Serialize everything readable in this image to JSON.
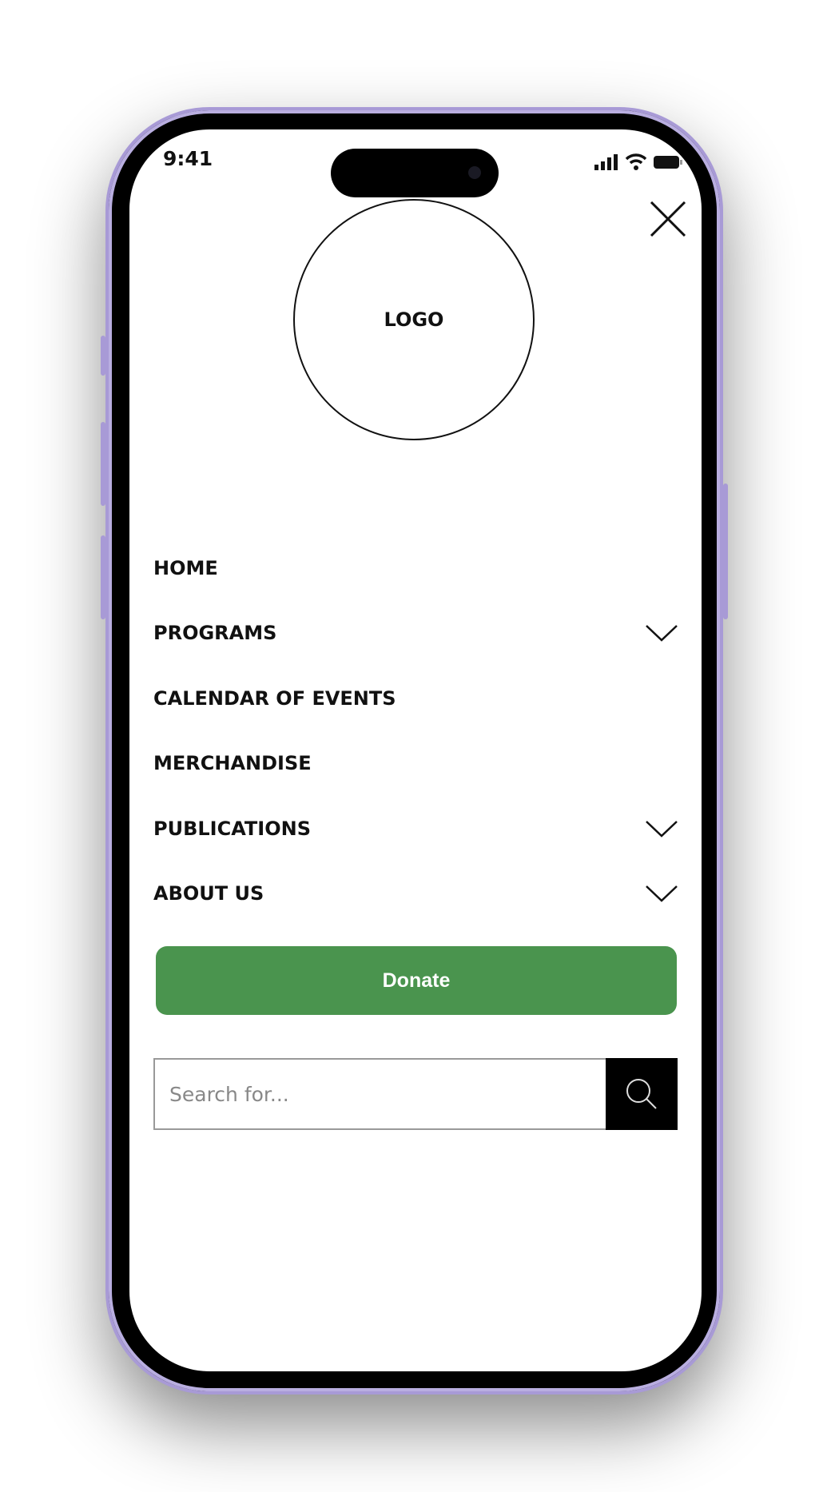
{
  "status_bar": {
    "time": "9:41",
    "icons": [
      "signal-icon",
      "wifi-icon",
      "battery-icon"
    ]
  },
  "header": {
    "logo_text": "LOGO",
    "close_icon": "close-icon"
  },
  "menu": {
    "items": [
      {
        "label": "HOME",
        "has_submenu": false
      },
      {
        "label": "PROGRAMS",
        "has_submenu": true
      },
      {
        "label": "CALENDAR OF EVENTS",
        "has_submenu": false
      },
      {
        "label": "MERCHANDISE",
        "has_submenu": false
      },
      {
        "label": "PUBLICATIONS",
        "has_submenu": true
      },
      {
        "label": "ABOUT US",
        "has_submenu": true
      }
    ]
  },
  "donate": {
    "label": "Donate",
    "color": "#4a944e"
  },
  "search": {
    "placeholder": "Search for...",
    "value": "",
    "icon": "search-icon"
  }
}
